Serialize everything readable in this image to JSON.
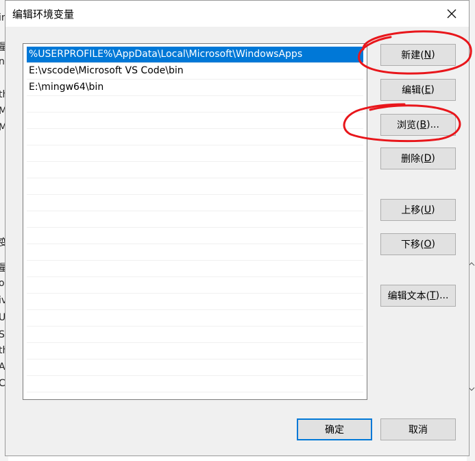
{
  "dialog": {
    "title": "编辑环境变量",
    "close_symbol": "✕"
  },
  "path_list": [
    "%USERPROFILE%\\AppData\\Local\\Microsoft\\WindowsApps",
    "E:\\vscode\\Microsoft VS Code\\bin",
    "E:\\mingw64\\bin"
  ],
  "selected_index": 0,
  "buttons": {
    "new": {
      "label": "新建(",
      "key": "N",
      "tail": ")"
    },
    "edit": {
      "label": "编辑(",
      "key": "E",
      "tail": ")"
    },
    "browse": {
      "label": "浏览(",
      "key": "B",
      "tail": ")..."
    },
    "delete": {
      "label": "删除(",
      "key": "D",
      "tail": ")"
    },
    "move_up": {
      "label": "上移(",
      "key": "U",
      "tail": ")"
    },
    "move_down": {
      "label": "下移(",
      "key": "O",
      "tail": ")"
    },
    "edit_text": {
      "label": "编辑文本(",
      "key": "T",
      "tail": ")..."
    },
    "ok": "确定",
    "cancel": "取消"
  },
  "background_fragments": [
    "量",
    "ne",
    "th",
    "M",
    "MI",
    "变",
    "量",
    "or",
    "iv",
    "U",
    "S",
    "th",
    "A",
    "C",
    "in"
  ],
  "colors": {
    "selection": "#0078d7",
    "annotation": "#e8161b"
  }
}
